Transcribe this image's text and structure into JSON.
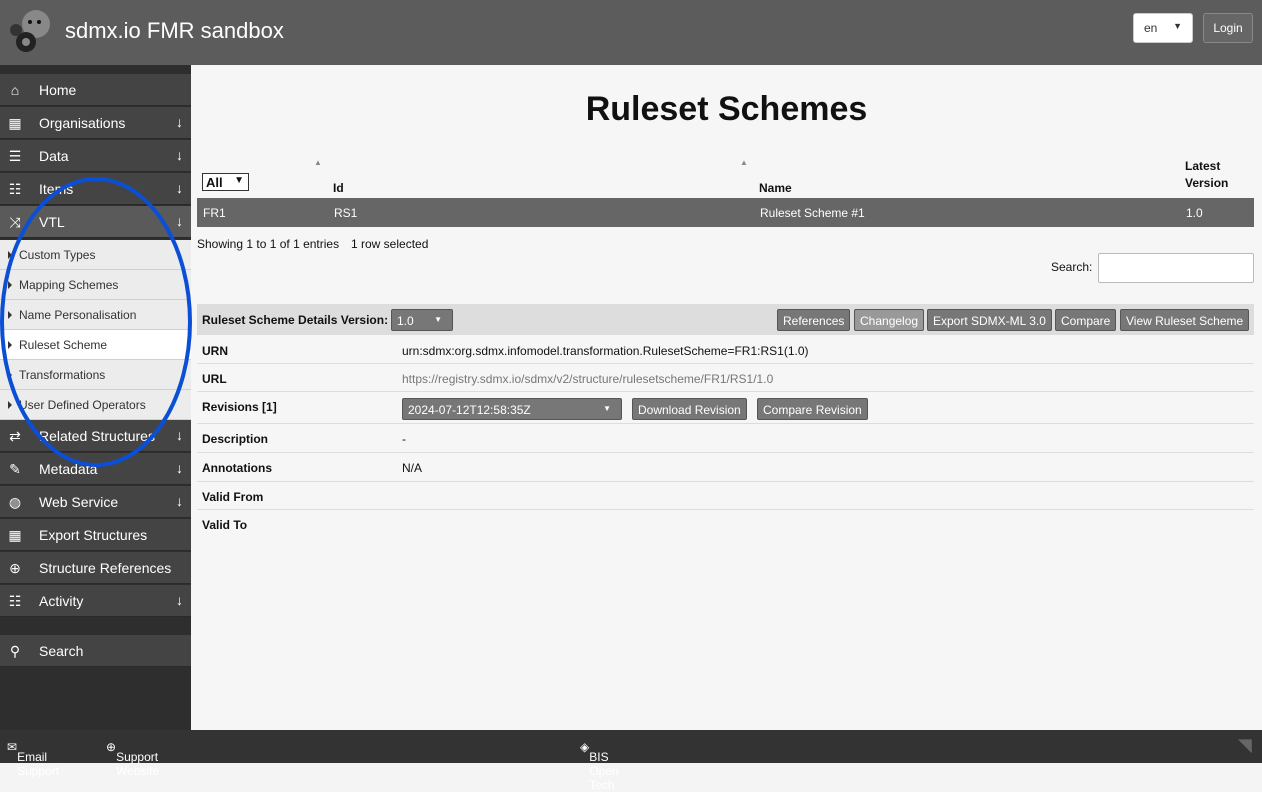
{
  "header": {
    "title": "sdmx.io FMR sandbox",
    "language": "en",
    "login": "Login"
  },
  "sidebar": {
    "items": [
      {
        "label": "Home",
        "icon": "home-icon",
        "arrow": false
      },
      {
        "label": "Organisations",
        "icon": "building-icon",
        "arrow": true
      },
      {
        "label": "Data",
        "icon": "chart-icon",
        "arrow": true
      },
      {
        "label": "Items",
        "icon": "list-icon",
        "arrow": true
      },
      {
        "label": "VTL",
        "icon": "shuffle-icon",
        "arrow": true
      }
    ],
    "vtl_sub": [
      "Custom Types",
      "Mapping Schemes",
      "Name Personalisation",
      "Ruleset Scheme",
      "Transformations",
      "User Defined Operators"
    ],
    "items2": [
      {
        "label": "Related Structures",
        "icon": "exchange-icon",
        "arrow": true
      },
      {
        "label": "Metadata",
        "icon": "pencil-icon",
        "arrow": true
      },
      {
        "label": "Web Service",
        "icon": "globe-icon",
        "arrow": true
      },
      {
        "label": "Export Structures",
        "icon": "table-icon",
        "arrow": false
      },
      {
        "label": "Structure References",
        "icon": "crosshair-icon",
        "arrow": false
      },
      {
        "label": "Activity",
        "icon": "list-icon",
        "arrow": true
      }
    ],
    "search": "Search"
  },
  "main": {
    "title": "Ruleset Schemes",
    "filter": "All",
    "columns": [
      "Id",
      "Name",
      "Latest Version"
    ],
    "rows": [
      {
        "agency": "FR1",
        "id": "RS1",
        "name": "Ruleset Scheme #1",
        "version": "1.0"
      }
    ],
    "info": "Showing 1 to 1 of 1 entries",
    "selected": "1 row selected",
    "search_label": "Search:",
    "details": {
      "label": "Ruleset Scheme Details Version:",
      "version": "1.0",
      "buttons": [
        "References",
        "Changelog",
        "Export SDMX-ML 3.0",
        "Compare",
        "View Ruleset Scheme"
      ],
      "urn_label": "URN",
      "urn": "urn:sdmx:org.sdmx.infomodel.transformation.RulesetScheme=FR1:RS1(1.0)",
      "url_label": "URL",
      "url": "https://registry.sdmx.io/sdmx/v2/structure/rulesetscheme/FR1/RS1/1.0",
      "revisions_label": "Revisions [1]",
      "revision": "2024-07-12T12:58:35Z",
      "download_revision": "Download Revision",
      "compare_revision": "Compare Revision",
      "description_label": "Description",
      "description": "-",
      "annotations_label": "Annotations",
      "annotations": "N/A",
      "valid_from_label": "Valid From",
      "valid_to_label": "Valid To"
    }
  },
  "footer": {
    "email": "Email Support",
    "website": "Support Website",
    "bis": "BIS Open Tech"
  },
  "annotation_color": "#0a4fd6"
}
